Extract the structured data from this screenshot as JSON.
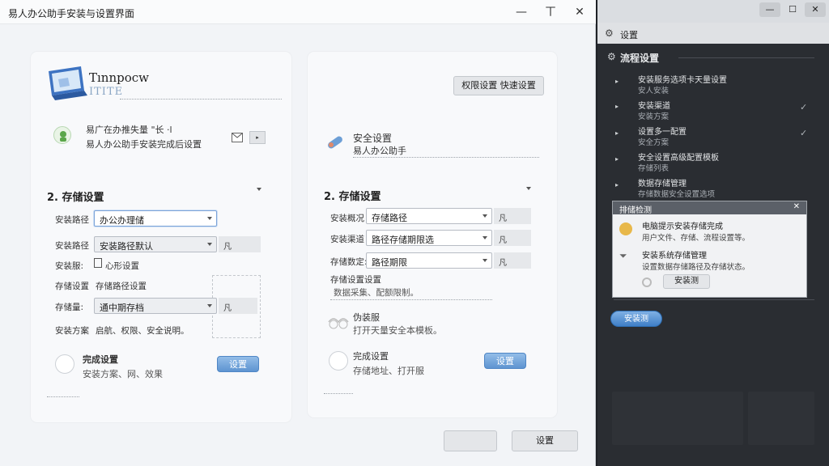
{
  "window": {
    "title": "易人办公助手安装与设置界面",
    "controls": {
      "minimize": "—",
      "maximize": "ㄒ",
      "close": "✕"
    }
  },
  "left_card": {
    "logo_title": "Tınnpocw",
    "logo_sub": "ITITE",
    "feature_line1": "易广在办推失量 \"长 ·l",
    "feature_line2": "易人办公助手安装完成后设置",
    "section_title": "2. 存储设置",
    "rows": [
      {
        "label": "安装路径",
        "value": "办公办理储",
        "tail": ""
      },
      {
        "label": "安装路径",
        "value": "安装路径默认",
        "tail": "凡"
      },
      {
        "label": "安装服:",
        "value": "心形设置",
        "tail": ""
      },
      {
        "label": "存储设置",
        "value": "存储路径设置",
        "tail": ""
      },
      {
        "label": "存储量:",
        "value": "通中期存档",
        "tail": "凡"
      },
      {
        "label": "安装方案",
        "value": "启航、权限、安全说明。",
        "tail": ""
      }
    ],
    "option_title": "完成设置",
    "option_sub": "安装方案、网、效果",
    "option_button": "设置"
  },
  "right_card": {
    "header_title": "权限设置",
    "header_title2": "快速设置",
    "tool_title": "安全设置",
    "tool_sub": "易人办公助手",
    "section_title": "2. 存储设置",
    "rows": [
      {
        "label": "安装概况",
        "value": "存储路径",
        "tail": "凡"
      },
      {
        "label": "安装渠道",
        "value": "路径存储期限选",
        "tail": "凡"
      },
      {
        "label": "存储数定:",
        "value": "路径期限",
        "tail": "凡"
      }
    ],
    "sub_title": "存储设置设置",
    "sub_text": "数据采集、配额限制。",
    "opt1_title": "伪装服",
    "opt1_sub": "打开天量安全本模板。",
    "opt2_title": "完成设置",
    "opt2_sub": "存储地址、打开服",
    "opt2_button": "设置"
  },
  "footer": {
    "cancel": "",
    "ok": "设置"
  },
  "panel": {
    "controls": {
      "minimize": "—",
      "maximize": "☐",
      "close": "✕"
    },
    "head_title": "设置",
    "section": "流程设置",
    "items": [
      {
        "title": "安装服务选项卡天量设置",
        "sub": "安人安装",
        "check": ""
      },
      {
        "title": "安装渠道",
        "sub": "安装方案",
        "check": "✓"
      },
      {
        "title": "设置多一配置",
        "sub": "安全方案",
        "check": "✓"
      },
      {
        "title": "安全设置高级配置模板",
        "sub": "存储列表",
        "check": ""
      },
      {
        "title": "数据存储管理",
        "sub": "存储数据安全设置选项",
        "check": ""
      }
    ],
    "popup_title": "排储检测",
    "popup_close": "✕",
    "popup_line1": "电脑提示安装存储完成",
    "popup_line1_sub": "用户文件、存储、流程设置等。",
    "popup_line2": "安装系统存储管理",
    "popup_line2_sub": "设置数据存储路径及存储状态。",
    "popup_button": "安装测",
    "bottom_button": "安装测"
  }
}
